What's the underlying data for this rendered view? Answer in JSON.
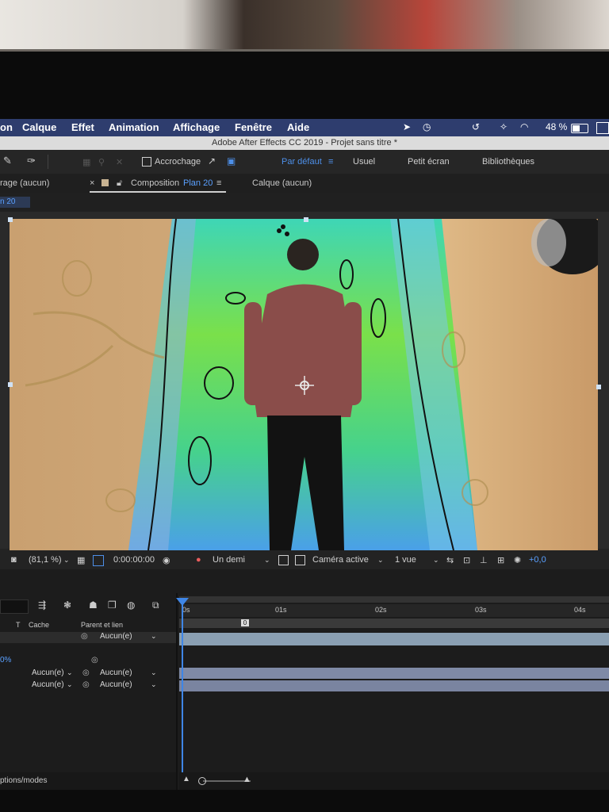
{
  "menubar": {
    "items": [
      "on",
      "Calque",
      "Effet",
      "Animation",
      "Affichage",
      "Fenêtre",
      "Aide"
    ],
    "battery": "48 %"
  },
  "window_title": "Adobe After Effects CC 2019 - Projet sans titre *",
  "toolbar": {
    "snapping_label": "Accrochage",
    "workspaces": [
      "Par défaut",
      "Usuel",
      "Petit écran",
      "Bibliothèques"
    ]
  },
  "panels": {
    "left_panel": "rage (aucun)",
    "left_sub": "n 20",
    "composition_label": "Composition",
    "composition_name": "Plan 20",
    "layer_panel": "Calque (aucun)"
  },
  "viewer_controls": {
    "zoom": "(81,1 %)",
    "timecode": "0:00:00:00",
    "resolution": "Un demi",
    "camera": "Caméra active",
    "views": "1 vue",
    "exposure": "+0,0"
  },
  "timeline": {
    "col_t": "T",
    "col_cache": "Cache",
    "col_parent": "Parent et lien",
    "percent": "0%",
    "none_value": "Aucun(e)",
    "rows": [
      {
        "mode": "",
        "parent": "Aucun(e)"
      },
      {
        "mode": "Aucun(e)",
        "parent": "Aucun(e)"
      },
      {
        "mode": "Aucun(e)",
        "parent": "Aucun(e)"
      }
    ],
    "ruler": [
      "0s",
      "01s",
      "02s",
      "03s",
      "04s"
    ],
    "marker": "0",
    "footer": "ptions/modes"
  },
  "colors": {
    "menubar": "#2e3d6e",
    "accent": "#4d8fe8",
    "playhead": "#3f86e6",
    "layer_bar": "#8a9fb2"
  }
}
